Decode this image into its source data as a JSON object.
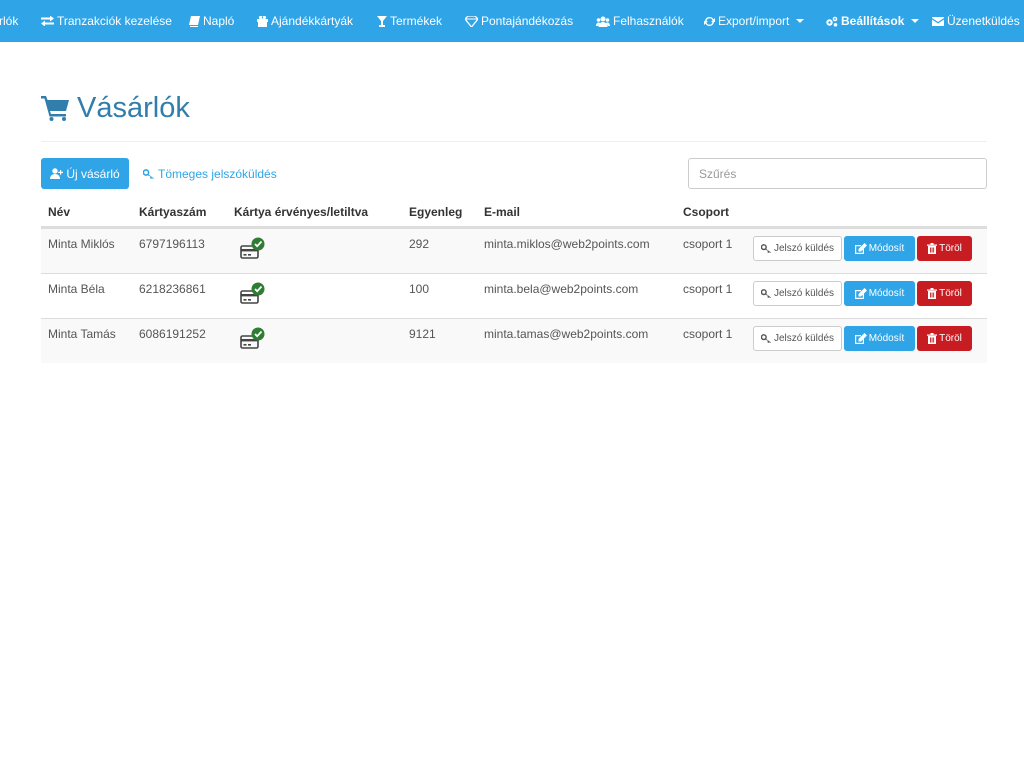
{
  "nav": {
    "items": [
      {
        "label": "rlók",
        "icon": ""
      },
      {
        "label": "Tranzakciók kezelése",
        "icon": "exchange-icon"
      },
      {
        "label": "Napló",
        "icon": "book-icon"
      },
      {
        "label": "Ajándékkártyák",
        "icon": "gift-icon"
      },
      {
        "label": "Termékek",
        "icon": "glass-icon"
      },
      {
        "label": "Pontajándékozás",
        "icon": "diamond-icon"
      },
      {
        "label": "Felhasználók",
        "icon": "users-icon"
      },
      {
        "label": "Export/import",
        "icon": "refresh-icon",
        "dropdown": true
      },
      {
        "label": "Beállítások",
        "icon": "cogs-icon",
        "dropdown": true
      },
      {
        "label": "Üzenetküldés",
        "icon": "envelope-icon"
      }
    ]
  },
  "page": {
    "title": "Vásárlók",
    "icon": "shopping-cart-icon"
  },
  "toolbar": {
    "new_label": "Új vásárló",
    "mass_label": "Tömeges jelszóküldés",
    "search_placeholder": "Szűrés",
    "search_value": ""
  },
  "table": {
    "headers": {
      "name": "Név",
      "card": "Kártyaszám",
      "valid": "Kártya érvényes/letiltva",
      "balance": "Egyenleg",
      "email": "E-mail",
      "group": "Csoport"
    },
    "rows": [
      {
        "name": "Minta Miklós",
        "card": "6797196113",
        "valid": true,
        "balance": "292",
        "email": "minta.miklos@web2points.com",
        "group": "csoport 1"
      },
      {
        "name": "Minta Béla",
        "card": "6218236861",
        "valid": true,
        "balance": "100",
        "email": "minta.bela@web2points.com",
        "group": "csoport 1"
      },
      {
        "name": "Minta Tamás",
        "card": "6086191252",
        "valid": true,
        "balance": "9121",
        "email": "minta.tamas@web2points.com",
        "group": "csoport 1"
      }
    ],
    "actions": {
      "password_label": "Jelszó küldés",
      "edit_label": "Módosít",
      "delete_label": "Töröl"
    }
  },
  "colors": {
    "primary": "#2fa4e7",
    "title": "#317eac",
    "danger": "#c71c22",
    "success": "#2e7d32"
  }
}
